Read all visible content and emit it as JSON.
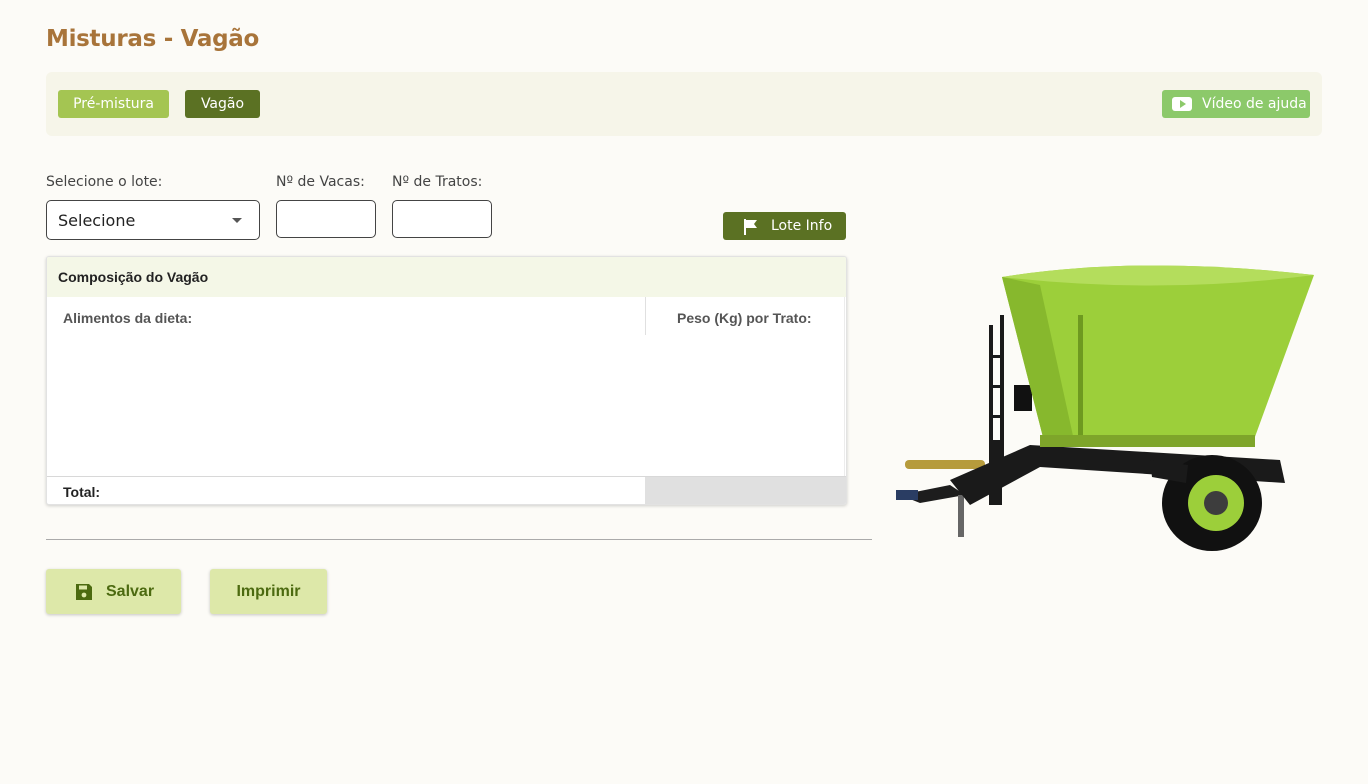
{
  "page": {
    "title": "Misturas - Vagão"
  },
  "tabs": [
    {
      "label": "Pré-mistura",
      "active": false
    },
    {
      "label": "Vagão",
      "active": true
    }
  ],
  "help_button": {
    "label": "Vídeo de ajuda",
    "icon": "youtube-icon"
  },
  "form": {
    "lote_label": "Selecione o lote:",
    "lote_value": "Selecione",
    "vacas_label": "Nº de Vacas:",
    "vacas_value": "",
    "tratos_label": "Nº de Tratos:",
    "tratos_value": ""
  },
  "lote_info_button": {
    "label": "Lote Info",
    "icon": "flag-icon"
  },
  "composition": {
    "title": "Composição do Vagão",
    "columns": [
      "Alimentos da dieta:",
      "Peso (Kg) por Trato:"
    ],
    "rows": [],
    "total_label": "Total:",
    "total_value": ""
  },
  "actions": {
    "save_label": "Salvar",
    "print_label": "Imprimir"
  },
  "colors": {
    "title": "#a8743a",
    "tab_inactive": "#a4c552",
    "tab_active": "#5b7123",
    "help": "#8cc96a",
    "wagon_green": "#9ccf3a"
  }
}
